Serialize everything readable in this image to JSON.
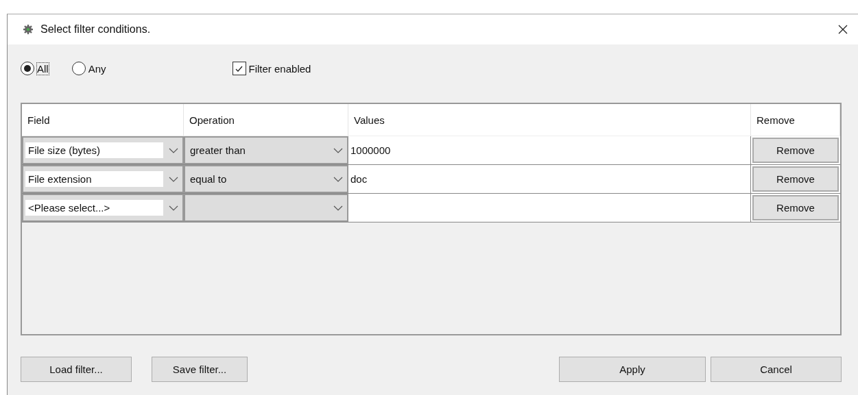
{
  "window": {
    "title": "Select filter conditions."
  },
  "match_mode": [
    {
      "label": "All",
      "selected": true
    },
    {
      "label": "Any",
      "selected": false
    }
  ],
  "filter_enabled": {
    "label": "Filter enabled",
    "checked": true
  },
  "table": {
    "columns": [
      "Field",
      "Operation",
      "Values",
      "Remove"
    ],
    "rows": [
      {
        "field": "File size (bytes)",
        "operation": "greater than",
        "value": "1000000",
        "remove": "Remove"
      },
      {
        "field": "File extension",
        "operation": "equal to",
        "value": "doc",
        "remove": "Remove"
      },
      {
        "field": "<Please select...>",
        "remove": "Remove"
      }
    ]
  },
  "buttons_left": [
    "Load filter...",
    "Save filter..."
  ],
  "buttons_right": [
    "Apply",
    "Cancel"
  ]
}
